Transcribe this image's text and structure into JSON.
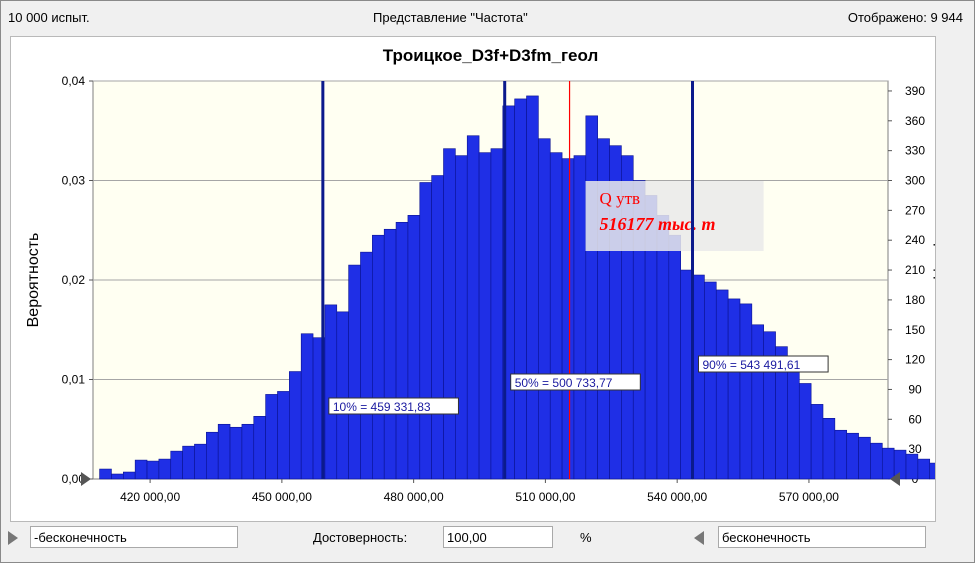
{
  "header": {
    "trials": "10 000 испыт.",
    "view_mode": "Представление \"Частота\"",
    "displayed": "Отображено: 9 944"
  },
  "chart_data": {
    "type": "bar",
    "title": "Троицкое_D3f+D3fm_геол",
    "ylabel": "Вероятность",
    "y2label": "Периодичность",
    "xlim": [
      407000,
      588000
    ],
    "ylim": [
      0,
      0.04
    ],
    "y2lim": [
      0,
      400
    ],
    "x_ticks": [
      420000,
      450000,
      480000,
      510000,
      540000,
      570000
    ],
    "x_tick_labels": [
      "420 000,00",
      "450 000,00",
      "480 000,00",
      "510 000,00",
      "540 000,00",
      "570 000,00"
    ],
    "y_ticks": [
      0,
      0.01,
      0.02,
      0.03,
      0.04
    ],
    "y_tick_labels": [
      "0,00",
      "0,01",
      "0,02",
      "0,03",
      "0,04"
    ],
    "y2_ticks": [
      0,
      30,
      60,
      90,
      120,
      150,
      180,
      210,
      240,
      270,
      300,
      330,
      360,
      390
    ],
    "bin_start": 408500,
    "bin_width": 2700,
    "values": [
      0.001,
      0.0005,
      0.0007,
      0.0019,
      0.0018,
      0.002,
      0.0028,
      0.0033,
      0.0035,
      0.0047,
      0.0055,
      0.0052,
      0.0055,
      0.0063,
      0.0085,
      0.0088,
      0.0108,
      0.0146,
      0.0142,
      0.0175,
      0.0168,
      0.0215,
      0.0228,
      0.0245,
      0.0251,
      0.0258,
      0.0265,
      0.0298,
      0.0305,
      0.0332,
      0.0325,
      0.0345,
      0.0328,
      0.0332,
      0.0375,
      0.0382,
      0.0385,
      0.0342,
      0.0328,
      0.0322,
      0.0325,
      0.0365,
      0.0342,
      0.0335,
      0.0325,
      0.03,
      0.0285,
      0.0265,
      0.0245,
      0.021,
      0.0205,
      0.0198,
      0.019,
      0.0181,
      0.0176,
      0.0155,
      0.0148,
      0.0133,
      0.0118,
      0.0096,
      0.0075,
      0.0061,
      0.0049,
      0.0046,
      0.0042,
      0.0036,
      0.0031,
      0.0029,
      0.0025,
      0.002,
      0.0016,
      0.0024,
      0.0008,
      0.0008,
      0.001
    ],
    "percentile_lines": [
      {
        "x": 459331.83,
        "label": "10% = 459 331,83"
      },
      {
        "x": 500733.77,
        "label": "50% = 500 733,77"
      },
      {
        "x": 543491.61,
        "label": "90% = 543 491,61"
      }
    ],
    "marker": {
      "x": 515500,
      "label_line1": "Q утв",
      "label_line2": "516177 тыс. т"
    },
    "colors": {
      "bar": "#1f2fe6",
      "bar_edge": "#0a1290",
      "plot_bg": "#fffff2",
      "percentile": "#0b1a8c",
      "marker": "#ff0000",
      "grid": "#a6a6a6"
    }
  },
  "footer": {
    "left_value": "-бесконечность",
    "certainty_label": "Достоверность:",
    "certainty_value": "100,00",
    "percent_sign": "%",
    "right_value": "бесконечность"
  }
}
